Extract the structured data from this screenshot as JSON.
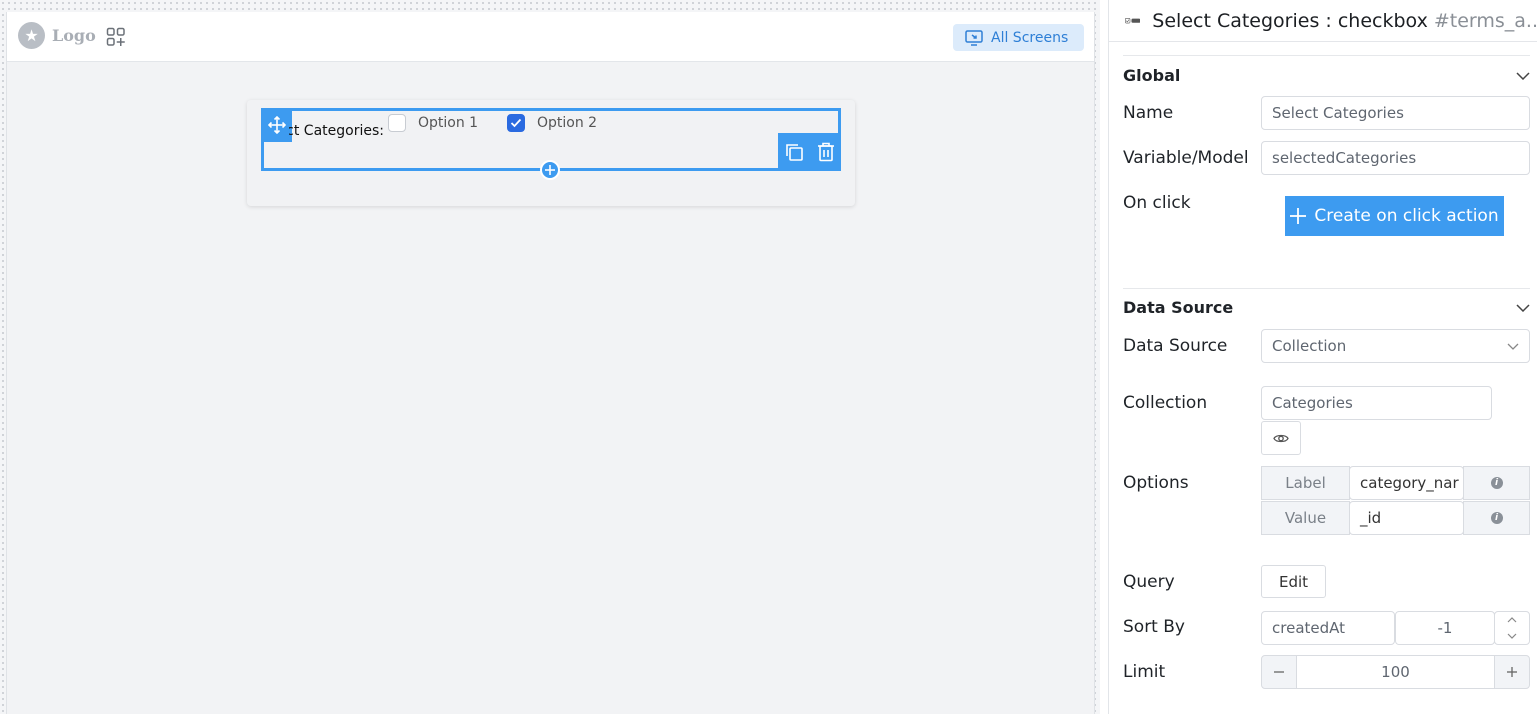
{
  "canvas": {
    "header": {
      "logo_text": "Logo",
      "all_screens_label": "All Screens"
    },
    "component": {
      "label": "Select Categories:",
      "options": [
        {
          "label": "Option 1",
          "checked": false
        },
        {
          "label": "Option 2",
          "checked": true
        }
      ]
    }
  },
  "panel": {
    "title": "Select Categories : checkbox",
    "title_id": "#terms_a..",
    "global": {
      "heading": "Global",
      "name_label": "Name",
      "name_value": "Select Categories",
      "variable_label": "Variable/Model",
      "variable_value": "selectedCategories",
      "onclick_label": "On click",
      "onclick_button": "Create on click action"
    },
    "data_source": {
      "heading": "Data Source",
      "source_label": "Data Source",
      "source_value": "Collection",
      "collection_label": "Collection",
      "collection_value": "Categories",
      "options_label": "Options",
      "option_label_addon": "Label",
      "option_label_value": "category_nar",
      "option_value_addon": "Value",
      "option_value_value": "_id",
      "query_label": "Query",
      "query_button": "Edit",
      "sort_label": "Sort By",
      "sort_field": "createdAt",
      "sort_order": "-1",
      "limit_label": "Limit",
      "limit_value": "100"
    }
  },
  "colors": {
    "accent": "#3d9bf0",
    "checkbox_checked": "#2a6ae0",
    "all_screens_bg": "#dcebfb"
  }
}
